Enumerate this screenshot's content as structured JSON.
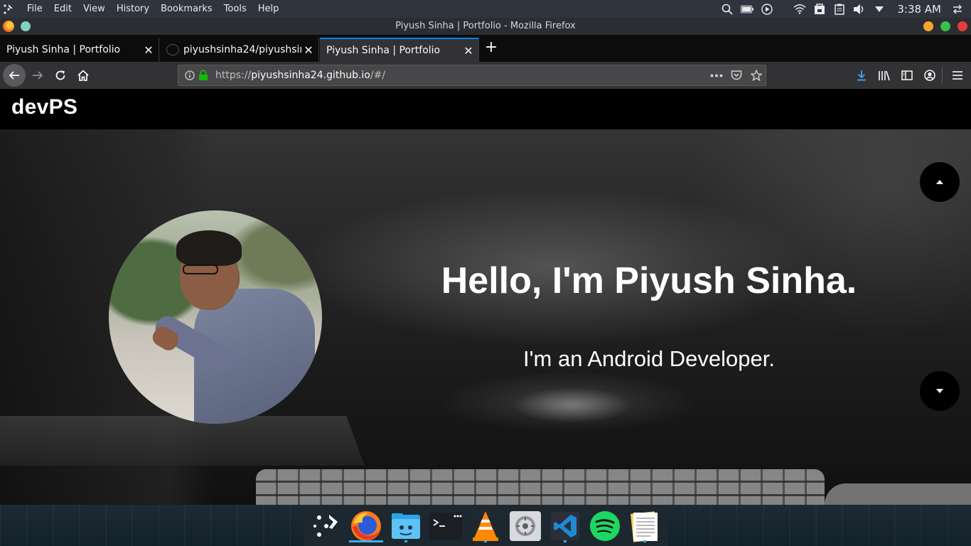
{
  "system_bar": {
    "menus": [
      "File",
      "Edit",
      "View",
      "History",
      "Bookmarks",
      "Tools",
      "Help"
    ],
    "clock": "3:38 AM"
  },
  "window": {
    "title": "Piyush Sinha | Portfolio - Mozilla Firefox"
  },
  "tabs": [
    {
      "label": "Piyush Sinha | Portfolio",
      "active": false
    },
    {
      "label": "piyushsinha24/piyushsinha",
      "active": false
    },
    {
      "label": "Piyush Sinha | Portfolio",
      "active": true
    }
  ],
  "address_bar": {
    "scheme": "https://",
    "host": "piyushsinha24.github.io",
    "path": "/#/"
  },
  "site": {
    "brand": "devPS",
    "greeting": "Hello, I'm Piyush Sinha.",
    "role": "I'm an Android Developer."
  },
  "dock": {
    "apps": [
      "app-launcher",
      "firefox",
      "file-manager",
      "terminal",
      "vlc",
      "system-settings",
      "vscode",
      "spotify",
      "notes"
    ]
  },
  "colors": {
    "accent": "#0a84ff",
    "dock_indicator": "#3daee9"
  }
}
